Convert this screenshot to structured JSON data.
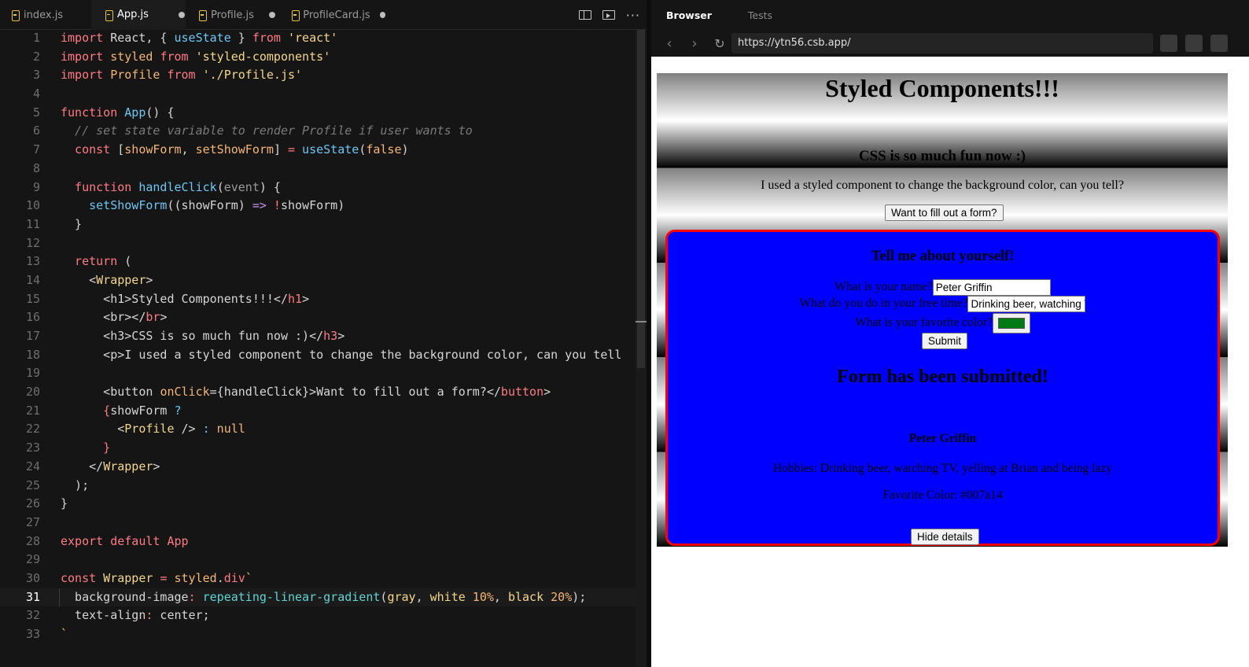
{
  "editor": {
    "tabs": [
      {
        "label": "index.js",
        "modified": false
      },
      {
        "label": "App.js",
        "modified": true
      },
      {
        "label": "Profile.js",
        "modified": true
      },
      {
        "label": "ProfileCard.js",
        "modified": true
      }
    ],
    "line_numbers": [
      "1",
      "2",
      "3",
      "4",
      "5",
      "6",
      "7",
      "8",
      "9",
      "10",
      "11",
      "12",
      "13",
      "14",
      "15",
      "16",
      "17",
      "18",
      "19",
      "20",
      "21",
      "22",
      "23",
      "24",
      "25",
      "26",
      "27",
      "28",
      "29",
      "30",
      "31",
      "32",
      "33"
    ],
    "code": {
      "l1": {
        "a": "import",
        "b": " React, { ",
        "c": "useState",
        "d": " } ",
        "e": "from",
        "f": " 'react'"
      },
      "l2": {
        "a": "import",
        "b": " styled ",
        "c": "from",
        "d": " 'styled-components'"
      },
      "l3": {
        "a": "import",
        "b": " Profile ",
        "c": "from",
        "d": " './Profile.js'"
      },
      "l5": {
        "a": "function",
        "b": " App",
        "c": "() {"
      },
      "l6": {
        "a": "  // set state variable to render Profile if user wants to"
      },
      "l7": {
        "a": "  const",
        "b": " [",
        "c": "showForm",
        "d": ", ",
        "e": "setShowForm",
        "f": "] ",
        "g": "=",
        "h": " useState",
        "i": "(",
        "j": "false",
        "k": ")"
      },
      "l9": {
        "a": "  function",
        "b": " handleClick",
        "c": "(",
        "d": "event",
        "e": ") {"
      },
      "l10": {
        "a": "    setShowForm",
        "b": "((showForm) ",
        "c": "=>",
        "d": " !",
        "e": "showForm)"
      },
      "l11": {
        "a": "  }"
      },
      "l13": {
        "a": "  return",
        "b": " ("
      },
      "l14": {
        "a": "    <",
        "b": "Wrapper",
        "c": ">"
      },
      "l15": {
        "a": "      <h1>Styled Components!!!</",
        "b": "h1",
        "c": ">"
      },
      "l16": {
        "a": "      <br></",
        "b": "br",
        "c": ">"
      },
      "l17": {
        "a": "      <h3>CSS is so much fun now :)</",
        "b": "h3",
        "c": ">"
      },
      "l18": {
        "a": "      <p>I used a styled component to change the background color, can you tell"
      },
      "l20": {
        "a": "      <button ",
        "b": "onClick",
        "c": "={handleClick}>Want to fill out a form?</",
        "d": "button",
        "e": ">"
      },
      "l21": {
        "a": "      {",
        "b": "showForm ",
        "c": "?"
      },
      "l22": {
        "a": "        <",
        "b": "Profile",
        "c": " /> ",
        "d": ":",
        "e": " null"
      },
      "l23": {
        "a": "      }"
      },
      "l24": {
        "a": "    </",
        "b": "Wrapper",
        "c": ">"
      },
      "l25": {
        "a": "  );"
      },
      "l26": {
        "a": "}"
      },
      "l28": {
        "a": "export",
        "b": " default",
        "c": " App"
      },
      "l30": {
        "a": "const",
        "b": " Wrapper ",
        "c": "=",
        "d": " styled",
        "e": ".",
        "f": "div",
        "g": "`"
      },
      "l31": {
        "a": "  background-image",
        "b": ":",
        "c": " repeating-linear-gradient",
        "d": "(",
        "e": "gray",
        "f": ", ",
        "g": "white",
        "h": " 10%",
        "i": ", ",
        "j": "black",
        "k": " 20%",
        "l": ");"
      },
      "l32": {
        "a": "  text-align",
        "b": ":",
        "c": " center;"
      },
      "l33": {
        "a": "`"
      }
    }
  },
  "browser": {
    "tabs": [
      "Browser",
      "Tests"
    ],
    "nav": {
      "back": "‹",
      "forward": "›",
      "reload": "↻"
    },
    "url": "https://ytn56.csb.app/",
    "page": {
      "h1": "Styled Components!!!",
      "h3": "CSS is so much fun now :)",
      "intro": "I used a styled component to change the background color, can you tell?",
      "form_button": "Want to fill out a form?",
      "profile": {
        "title": "Tell me about yourself!",
        "name_label": "What is your name?",
        "name_value": "Peter Griffin",
        "free_label": "What do you do in your free time?",
        "free_value": "Drinking beer, watching TV, yelling at Brian and being lazy",
        "color_label": "What is your favorite color?",
        "color_value": "#007a14",
        "submit": "Submit",
        "submitted": "Form has been submitted!",
        "card_name": "Peter Griffin",
        "card_hobbies": "Hobbies: Drinking beer, watching TV, yelling at Brian and being lazy",
        "card_color": "Favorite Color: #007a14",
        "hide_button": "Hide details"
      }
    }
  }
}
